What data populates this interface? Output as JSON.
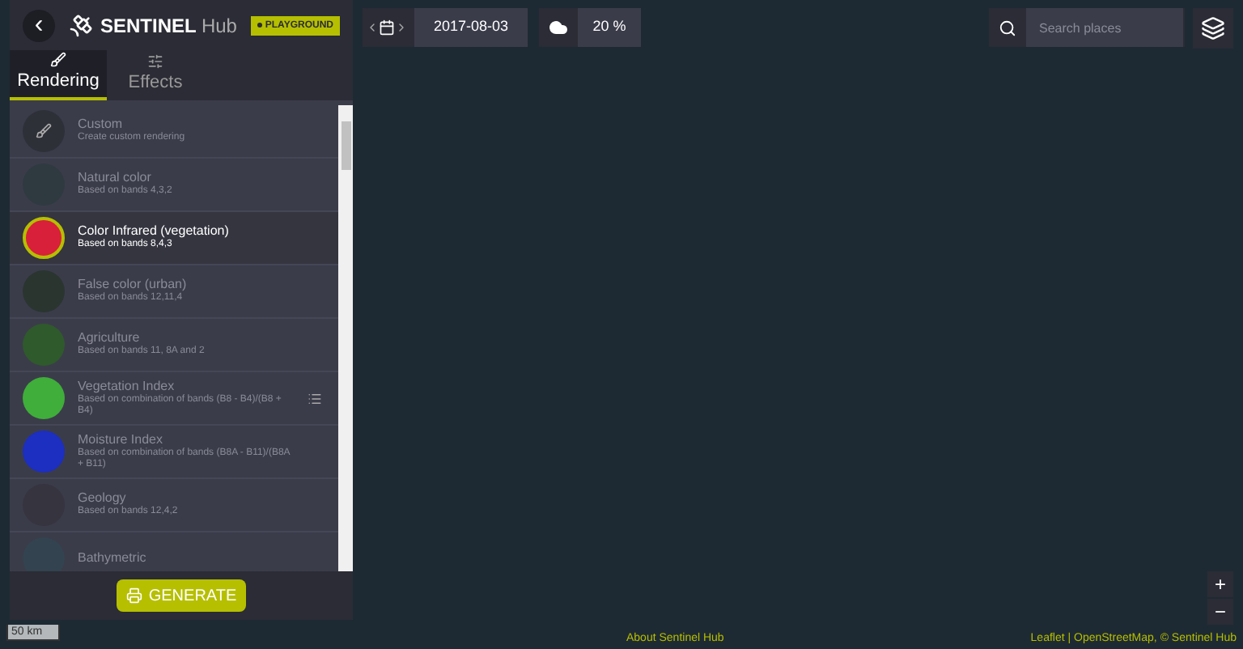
{
  "header": {
    "back": "‹",
    "logo_bold": "SENTINEL",
    "logo_light": "Hub",
    "badge": "PLAYGROUND"
  },
  "tabs": [
    {
      "label": "Rendering",
      "selected": true
    },
    {
      "label": "Effects",
      "selected": false
    }
  ],
  "renderings": [
    {
      "kind": "custom",
      "name": "Custom",
      "description": "Create custom rendering",
      "selected": false
    },
    {
      "kind": "plain",
      "name": "Natural color",
      "description": "Based on bands 4,3,2",
      "selected": false,
      "color": "#2f3a40"
    },
    {
      "kind": "plain",
      "name": "Color Infrared (vegetation)",
      "description": "Based on bands 8,4,3",
      "selected": true,
      "color": "#d8203a"
    },
    {
      "kind": "plain",
      "name": "False color (urban)",
      "description": "Based on bands 12,11,4",
      "selected": false,
      "color": "#2a3530"
    },
    {
      "kind": "plain",
      "name": "Agriculture",
      "description": "Based on bands 11, 8A and 2",
      "selected": false,
      "color": "#2f5a2c"
    },
    {
      "kind": "legend",
      "name": "Vegetation Index",
      "description": "Based on combination of bands (B8 - B4)/(B8 + B4)",
      "selected": false,
      "color": "#3fae3a"
    },
    {
      "kind": "legend-none",
      "name": "Moisture Index",
      "description": "Based on combination of bands (B8A - B11)/(B8A + B11)",
      "selected": false,
      "color": "#1c2fc0"
    },
    {
      "kind": "plain",
      "name": "Geology",
      "description": "Based on bands 12,4,2",
      "selected": false,
      "color": "#35343f"
    },
    {
      "kind": "plain",
      "name": "Bathymetric",
      "selected": false,
      "color": "#33434f"
    }
  ],
  "generate": "GENERATE",
  "date": "2017-08-03",
  "cloud": "20 %",
  "search": {
    "placeholder": "Search places"
  },
  "zoom": [
    "+",
    "−"
  ],
  "scale": "50 km",
  "about": "About Sentinel Hub",
  "attribution": "Leaflet | OpenStreetMap, © Sentinel Hub"
}
